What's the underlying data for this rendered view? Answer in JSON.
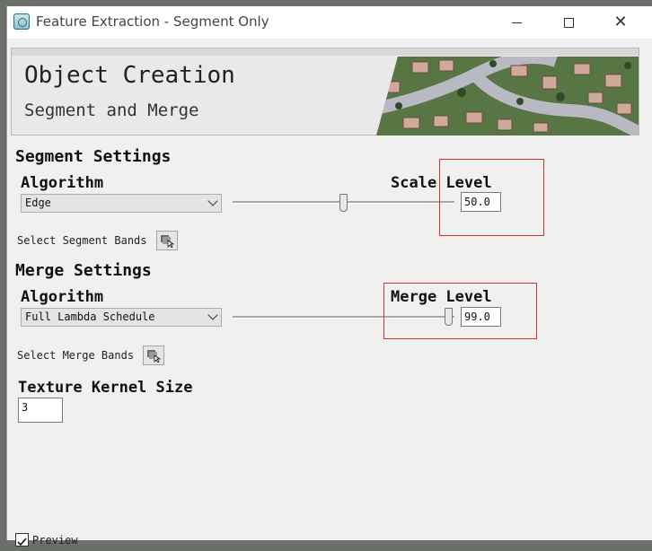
{
  "window": {
    "title": "Feature Extraction - Segment Only"
  },
  "banner": {
    "title": "Object Creation",
    "subtitle": "Segment and Merge"
  },
  "segment": {
    "heading": "Segment Settings",
    "algorithm_label": "Algorithm",
    "algorithm_value": "Edge",
    "scale_label": "Scale Level",
    "scale_value": "50.0",
    "scale_slider_fraction": 0.5,
    "bands_label": "Select Segment Bands"
  },
  "merge": {
    "heading": "Merge Settings",
    "algorithm_label": "Algorithm",
    "algorithm_value": "Full Lambda Schedule",
    "level_label": "Merge Level",
    "level_value": "99.0",
    "level_slider_fraction": 0.99,
    "bands_label": "Select Merge Bands"
  },
  "texture": {
    "label": "Texture Kernel Size",
    "value": "3"
  },
  "preview": {
    "label": "Preview",
    "checked": true
  },
  "colors": {
    "highlight": "#d23232",
    "banner_bg": "#e9e9e9"
  },
  "icons": {
    "app": "feature-extraction-icon",
    "bands": "band-select-icon"
  }
}
